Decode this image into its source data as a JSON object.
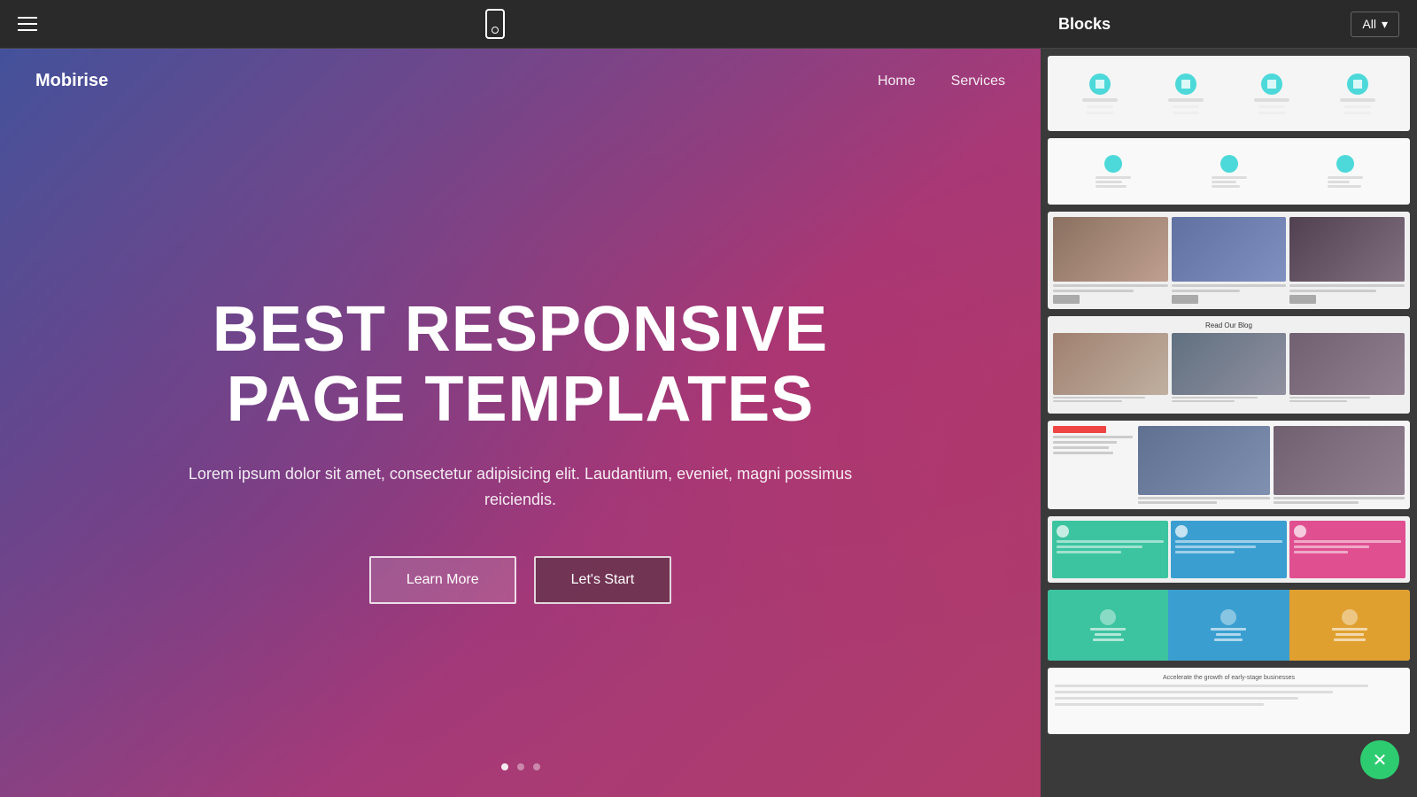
{
  "toolbar": {
    "hamburger_label": "menu"
  },
  "navbar": {
    "brand": "Mobirise",
    "links": [
      {
        "label": "Home",
        "id": "home"
      },
      {
        "label": "Services",
        "id": "services"
      }
    ]
  },
  "hero": {
    "title_line1": "BEST RESPONSIVE",
    "title_line2": "PAGE TEMPLATES",
    "subtitle": "Lorem ipsum dolor sit amet, consectetur adipisicing elit. Laudantium, eveniet, magni possimus reiciendis.",
    "btn_learn_more": "Learn More",
    "btn_lets_start": "Let's Start"
  },
  "blocks_panel": {
    "title": "Blocks",
    "filter_label": "All",
    "blocks": [
      {
        "id": "block-icons-row",
        "type": "icons"
      },
      {
        "id": "block-dots-row",
        "type": "dots"
      },
      {
        "id": "block-photo-cards",
        "type": "photos"
      },
      {
        "id": "block-blog-cards",
        "type": "blog"
      },
      {
        "id": "block-article-layout",
        "type": "article"
      },
      {
        "id": "block-colored-cols",
        "type": "colored"
      },
      {
        "id": "block-colorful-icons",
        "type": "colorful"
      },
      {
        "id": "block-text-section",
        "type": "text"
      }
    ]
  },
  "colors": {
    "accent_green": "#2ecc71",
    "hero_gradient_start": "rgba(60,80,160,0.85)",
    "hero_gradient_end": "rgba(200,50,100,0.75)"
  }
}
